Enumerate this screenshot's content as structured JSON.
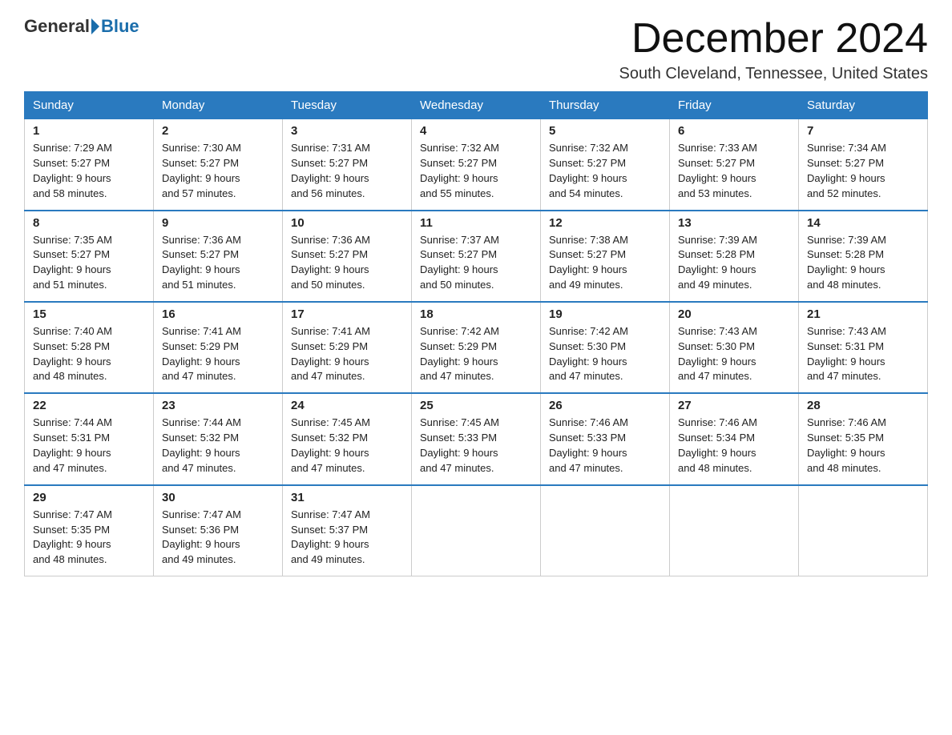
{
  "logo": {
    "general": "General",
    "blue": "Blue"
  },
  "header": {
    "month": "December 2024",
    "location": "South Cleveland, Tennessee, United States"
  },
  "weekdays": [
    "Sunday",
    "Monday",
    "Tuesday",
    "Wednesday",
    "Thursday",
    "Friday",
    "Saturday"
  ],
  "weeks": [
    [
      {
        "day": "1",
        "sunrise": "7:29 AM",
        "sunset": "5:27 PM",
        "daylight": "9 hours and 58 minutes."
      },
      {
        "day": "2",
        "sunrise": "7:30 AM",
        "sunset": "5:27 PM",
        "daylight": "9 hours and 57 minutes."
      },
      {
        "day": "3",
        "sunrise": "7:31 AM",
        "sunset": "5:27 PM",
        "daylight": "9 hours and 56 minutes."
      },
      {
        "day": "4",
        "sunrise": "7:32 AM",
        "sunset": "5:27 PM",
        "daylight": "9 hours and 55 minutes."
      },
      {
        "day": "5",
        "sunrise": "7:32 AM",
        "sunset": "5:27 PM",
        "daylight": "9 hours and 54 minutes."
      },
      {
        "day": "6",
        "sunrise": "7:33 AM",
        "sunset": "5:27 PM",
        "daylight": "9 hours and 53 minutes."
      },
      {
        "day": "7",
        "sunrise": "7:34 AM",
        "sunset": "5:27 PM",
        "daylight": "9 hours and 52 minutes."
      }
    ],
    [
      {
        "day": "8",
        "sunrise": "7:35 AM",
        "sunset": "5:27 PM",
        "daylight": "9 hours and 51 minutes."
      },
      {
        "day": "9",
        "sunrise": "7:36 AM",
        "sunset": "5:27 PM",
        "daylight": "9 hours and 51 minutes."
      },
      {
        "day": "10",
        "sunrise": "7:36 AM",
        "sunset": "5:27 PM",
        "daylight": "9 hours and 50 minutes."
      },
      {
        "day": "11",
        "sunrise": "7:37 AM",
        "sunset": "5:27 PM",
        "daylight": "9 hours and 50 minutes."
      },
      {
        "day": "12",
        "sunrise": "7:38 AM",
        "sunset": "5:27 PM",
        "daylight": "9 hours and 49 minutes."
      },
      {
        "day": "13",
        "sunrise": "7:39 AM",
        "sunset": "5:28 PM",
        "daylight": "9 hours and 49 minutes."
      },
      {
        "day": "14",
        "sunrise": "7:39 AM",
        "sunset": "5:28 PM",
        "daylight": "9 hours and 48 minutes."
      }
    ],
    [
      {
        "day": "15",
        "sunrise": "7:40 AM",
        "sunset": "5:28 PM",
        "daylight": "9 hours and 48 minutes."
      },
      {
        "day": "16",
        "sunrise": "7:41 AM",
        "sunset": "5:29 PM",
        "daylight": "9 hours and 47 minutes."
      },
      {
        "day": "17",
        "sunrise": "7:41 AM",
        "sunset": "5:29 PM",
        "daylight": "9 hours and 47 minutes."
      },
      {
        "day": "18",
        "sunrise": "7:42 AM",
        "sunset": "5:29 PM",
        "daylight": "9 hours and 47 minutes."
      },
      {
        "day": "19",
        "sunrise": "7:42 AM",
        "sunset": "5:30 PM",
        "daylight": "9 hours and 47 minutes."
      },
      {
        "day": "20",
        "sunrise": "7:43 AM",
        "sunset": "5:30 PM",
        "daylight": "9 hours and 47 minutes."
      },
      {
        "day": "21",
        "sunrise": "7:43 AM",
        "sunset": "5:31 PM",
        "daylight": "9 hours and 47 minutes."
      }
    ],
    [
      {
        "day": "22",
        "sunrise": "7:44 AM",
        "sunset": "5:31 PM",
        "daylight": "9 hours and 47 minutes."
      },
      {
        "day": "23",
        "sunrise": "7:44 AM",
        "sunset": "5:32 PM",
        "daylight": "9 hours and 47 minutes."
      },
      {
        "day": "24",
        "sunrise": "7:45 AM",
        "sunset": "5:32 PM",
        "daylight": "9 hours and 47 minutes."
      },
      {
        "day": "25",
        "sunrise": "7:45 AM",
        "sunset": "5:33 PM",
        "daylight": "9 hours and 47 minutes."
      },
      {
        "day": "26",
        "sunrise": "7:46 AM",
        "sunset": "5:33 PM",
        "daylight": "9 hours and 47 minutes."
      },
      {
        "day": "27",
        "sunrise": "7:46 AM",
        "sunset": "5:34 PM",
        "daylight": "9 hours and 48 minutes."
      },
      {
        "day": "28",
        "sunrise": "7:46 AM",
        "sunset": "5:35 PM",
        "daylight": "9 hours and 48 minutes."
      }
    ],
    [
      {
        "day": "29",
        "sunrise": "7:47 AM",
        "sunset": "5:35 PM",
        "daylight": "9 hours and 48 minutes."
      },
      {
        "day": "30",
        "sunrise": "7:47 AM",
        "sunset": "5:36 PM",
        "daylight": "9 hours and 49 minutes."
      },
      {
        "day": "31",
        "sunrise": "7:47 AM",
        "sunset": "5:37 PM",
        "daylight": "9 hours and 49 minutes."
      },
      null,
      null,
      null,
      null
    ]
  ],
  "labels": {
    "sunrise": "Sunrise: ",
    "sunset": "Sunset: ",
    "daylight": "Daylight: "
  }
}
